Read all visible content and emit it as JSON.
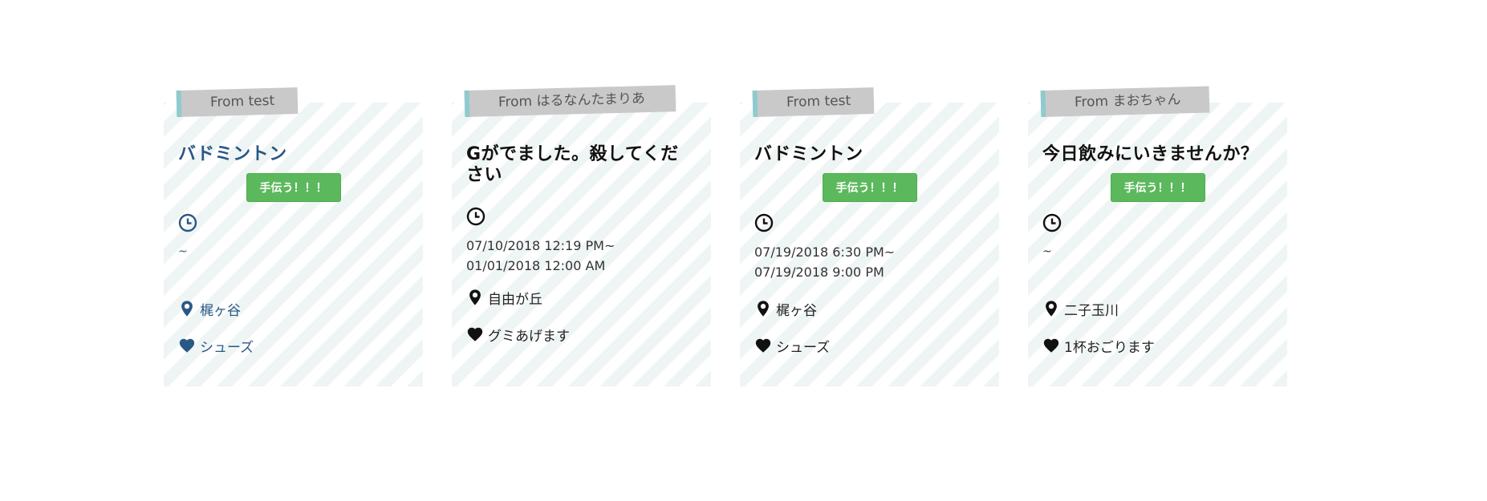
{
  "cards": [
    {
      "from": "From test",
      "title": "バドミントン",
      "help_label": "手伝う！！！",
      "time_line1": "~",
      "time_line2": "",
      "location": "梶ヶ谷",
      "reward": "シューズ",
      "accent": "#2a5885"
    },
    {
      "from": "From はるなんたまりあ",
      "title": "Gがでました。殺してください",
      "help_label": "",
      "time_line1": "07/10/2018 12:19 PM~",
      "time_line2": "01/01/2018 12:00 AM",
      "location": "自由が丘",
      "reward": "グミあげます",
      "accent": "#111111"
    },
    {
      "from": "From test",
      "title": "バドミントン",
      "help_label": "手伝う！！！",
      "time_line1": "07/19/2018 6:30 PM~",
      "time_line2": "07/19/2018 9:00 PM",
      "location": "梶ヶ谷",
      "reward": "シューズ",
      "accent": "#111111"
    },
    {
      "from": "From まおちゃん",
      "title": "今日飲みにいきませんか？",
      "help_label": "手伝う！！！",
      "time_line1": "~",
      "time_line2": "",
      "location": "二子玉川",
      "reward": "1杯おごります",
      "accent": "#111111"
    }
  ],
  "colors": {
    "help_button": "#5cb85c",
    "tag_background": "#c9c9c9",
    "tag_accent": "#8ecbcf",
    "stripe": "#eef5f4"
  },
  "icons": [
    "clock-icon",
    "map-pin-icon",
    "heart-icon"
  ]
}
